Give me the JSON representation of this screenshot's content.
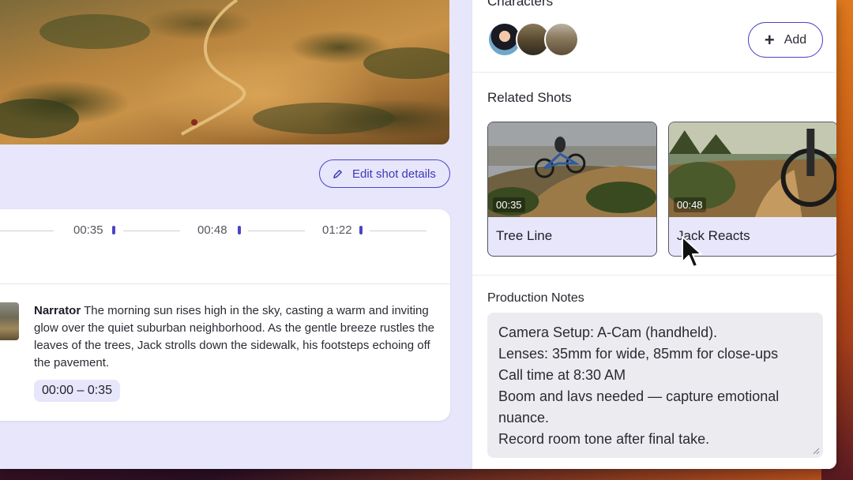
{
  "colors": {
    "accent": "#4b45c6",
    "panel_bg": "#e7e6fb",
    "notes_bg": "#ececf0"
  },
  "editor": {
    "edit_button_label": "Edit shot details",
    "timeline": [
      "00:35",
      "00:48",
      "01:22"
    ],
    "narration": {
      "speaker": "Narrator",
      "text": "The morning sun rises high in the sky, casting a warm and inviting glow over the quiet suburban neighborhood. As the gentle breeze rustles the leaves of the trees, Jack strolls down the sidewalk, his footsteps echoing off the pavement.",
      "time_range": "00:00 – 0:35"
    }
  },
  "sidebar": {
    "characters_title": "Characters",
    "add_label": "Add",
    "avatars": [
      "woman-avatar",
      "mountain-bike-avatar",
      "landscape-avatar"
    ],
    "related_shots_title": "Related Shots",
    "shots": [
      {
        "title": "Tree Line",
        "duration": "00:35"
      },
      {
        "title": "Jack Reacts",
        "duration": "00:48"
      }
    ],
    "production_notes_title": "Production Notes",
    "notes": [
      "Camera Setup: A-Cam (handheld).",
      "Lenses: 35mm for wide, 85mm for close-ups",
      "Call time at 8:30 AM",
      "Boom and lavs needed — capture emotional nuance.",
      "Record room tone after final take."
    ]
  }
}
